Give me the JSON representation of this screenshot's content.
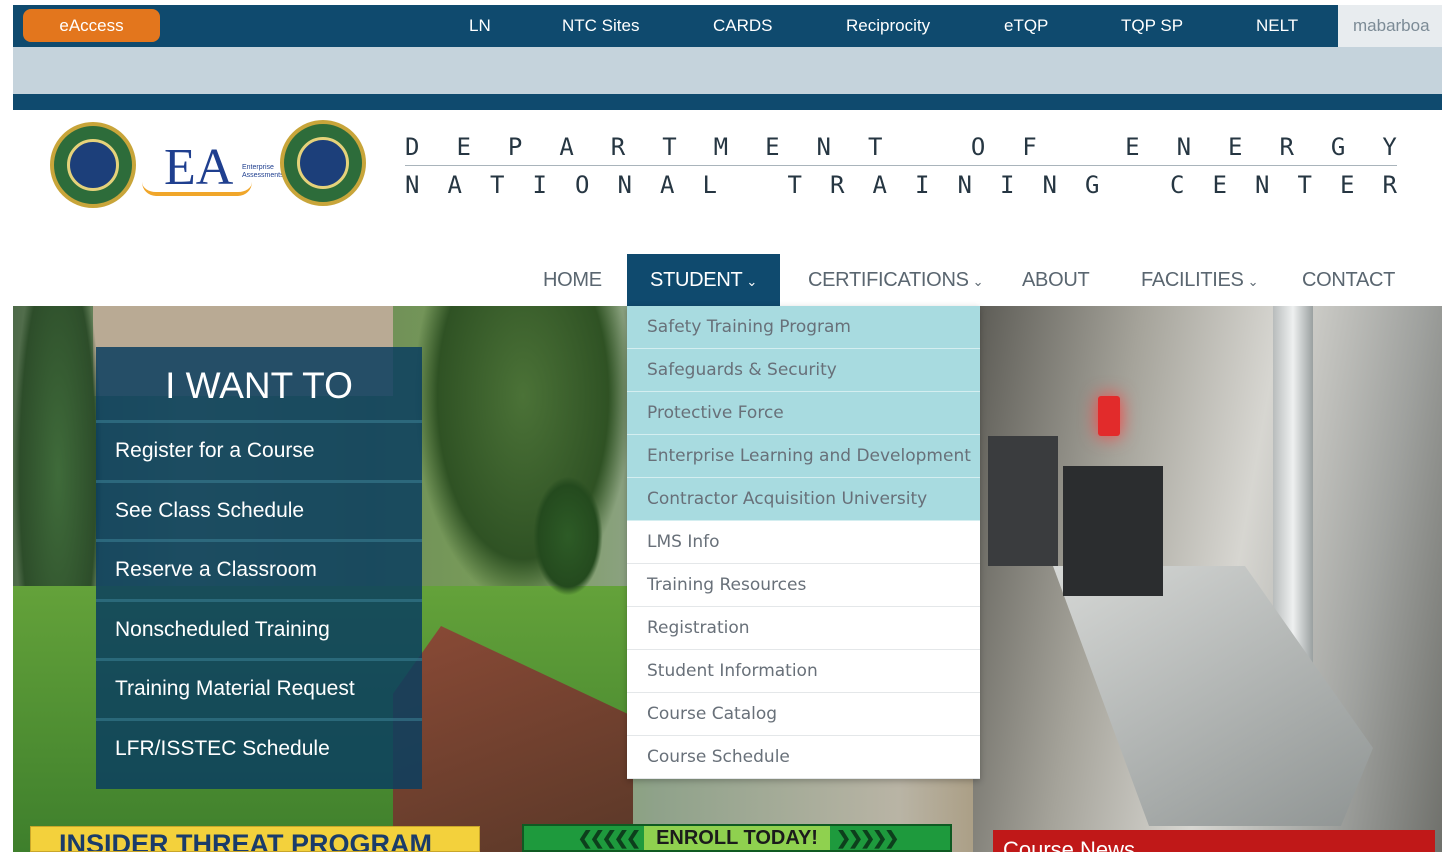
{
  "topbar": {
    "eaccess_label": "eAccess",
    "links": [
      {
        "label": "LN"
      },
      {
        "label": "NTC Sites"
      },
      {
        "label": "CARDS"
      },
      {
        "label": "Reciprocity"
      },
      {
        "label": "eTQP"
      },
      {
        "label": "TQP SP"
      },
      {
        "label": "NELT"
      }
    ],
    "user": "mabarboa"
  },
  "header": {
    "title_line1": [
      "D",
      "E",
      "P",
      "A",
      "R",
      "T",
      "M",
      "E",
      "N",
      "T",
      " ",
      "O",
      "F",
      " ",
      "E",
      "N",
      "E",
      "R",
      "G",
      "Y"
    ],
    "title_line2": [
      "N",
      "A",
      "T",
      "I",
      "O",
      "N",
      "A",
      "L",
      " ",
      "T",
      "R",
      "A",
      "I",
      "N",
      "I",
      "N",
      "G",
      " ",
      "C",
      "E",
      "N",
      "T",
      "E",
      "R"
    ],
    "ea_logo_text": "EA",
    "ea_logo_small": "Enterprise Assessments"
  },
  "nav": {
    "items": [
      {
        "label": "HOME",
        "has_dropdown": false
      },
      {
        "label": "STUDENT",
        "has_dropdown": true,
        "active": true
      },
      {
        "label": "CERTIFICATIONS",
        "has_dropdown": true
      },
      {
        "label": "ABOUT",
        "has_dropdown": false
      },
      {
        "label": "FACILITIES",
        "has_dropdown": true
      },
      {
        "label": "CONTACT",
        "has_dropdown": false
      }
    ],
    "chevron": "⌄"
  },
  "student_dropdown": {
    "items": [
      {
        "label": "Safety Training Program",
        "highlighted": true
      },
      {
        "label": "Safeguards & Security",
        "highlighted": true
      },
      {
        "label": "Protective Force",
        "highlighted": true
      },
      {
        "label": "Enterprise Learning and Development",
        "highlighted": true
      },
      {
        "label": "Contractor Acquisition University",
        "highlighted": true
      },
      {
        "label": "LMS Info",
        "highlighted": false
      },
      {
        "label": "Training Resources",
        "highlighted": false
      },
      {
        "label": "Registration",
        "highlighted": false
      },
      {
        "label": "Student Information",
        "highlighted": false
      },
      {
        "label": "Course Catalog",
        "highlighted": false
      },
      {
        "label": "Course Schedule",
        "highlighted": false
      }
    ]
  },
  "want_panel": {
    "title": "I WANT TO",
    "items": [
      {
        "label": "Register for a Course"
      },
      {
        "label": "See Class Schedule"
      },
      {
        "label": "Reserve a Classroom"
      },
      {
        "label": "Nonscheduled Training"
      },
      {
        "label": "Training Material Request"
      },
      {
        "label": "LFR/ISSTEC Schedule"
      }
    ]
  },
  "banners": {
    "insider": "INSIDER THREAT PROGRAM",
    "enroll": "ENROLL TODAY!",
    "enroll_left_arrows": "❮❮❮❮❮",
    "enroll_right_arrows": "❯❯❯❯❯",
    "course_news": "Course News"
  },
  "colors": {
    "brand_navy": "#0f4a6e",
    "eaccess_orange": "#e3761d",
    "dropdown_highlight": "#a8dbe0"
  }
}
